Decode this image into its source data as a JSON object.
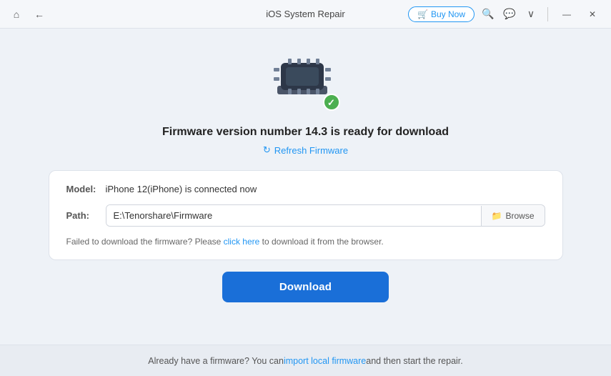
{
  "titlebar": {
    "title": "iOS System Repair",
    "buy_now_label": "Buy Now",
    "nav_back": "←",
    "nav_home": "⌂",
    "search_icon": "🔍",
    "chat_icon": "💬",
    "chevron_icon": "∨",
    "minimize_icon": "—",
    "close_icon": "✕"
  },
  "device": {
    "firmware_title": "Firmware version number 14.3 is ready for download",
    "refresh_label": "Refresh Firmware"
  },
  "card": {
    "model_label": "Model:",
    "model_value": "iPhone 12(iPhone) is connected now",
    "path_label": "Path:",
    "path_value": "E:\\Tenorshare\\Firmware",
    "browse_label": "Browse",
    "error_text_before": "Failed to download the firmware? Please ",
    "error_link": "click here",
    "error_text_after": " to download it from the browser."
  },
  "actions": {
    "download_label": "Download"
  },
  "footer": {
    "text_before": "Already have a firmware? You can ",
    "link_label": "import local firmware",
    "text_after": " and then start the repair."
  }
}
